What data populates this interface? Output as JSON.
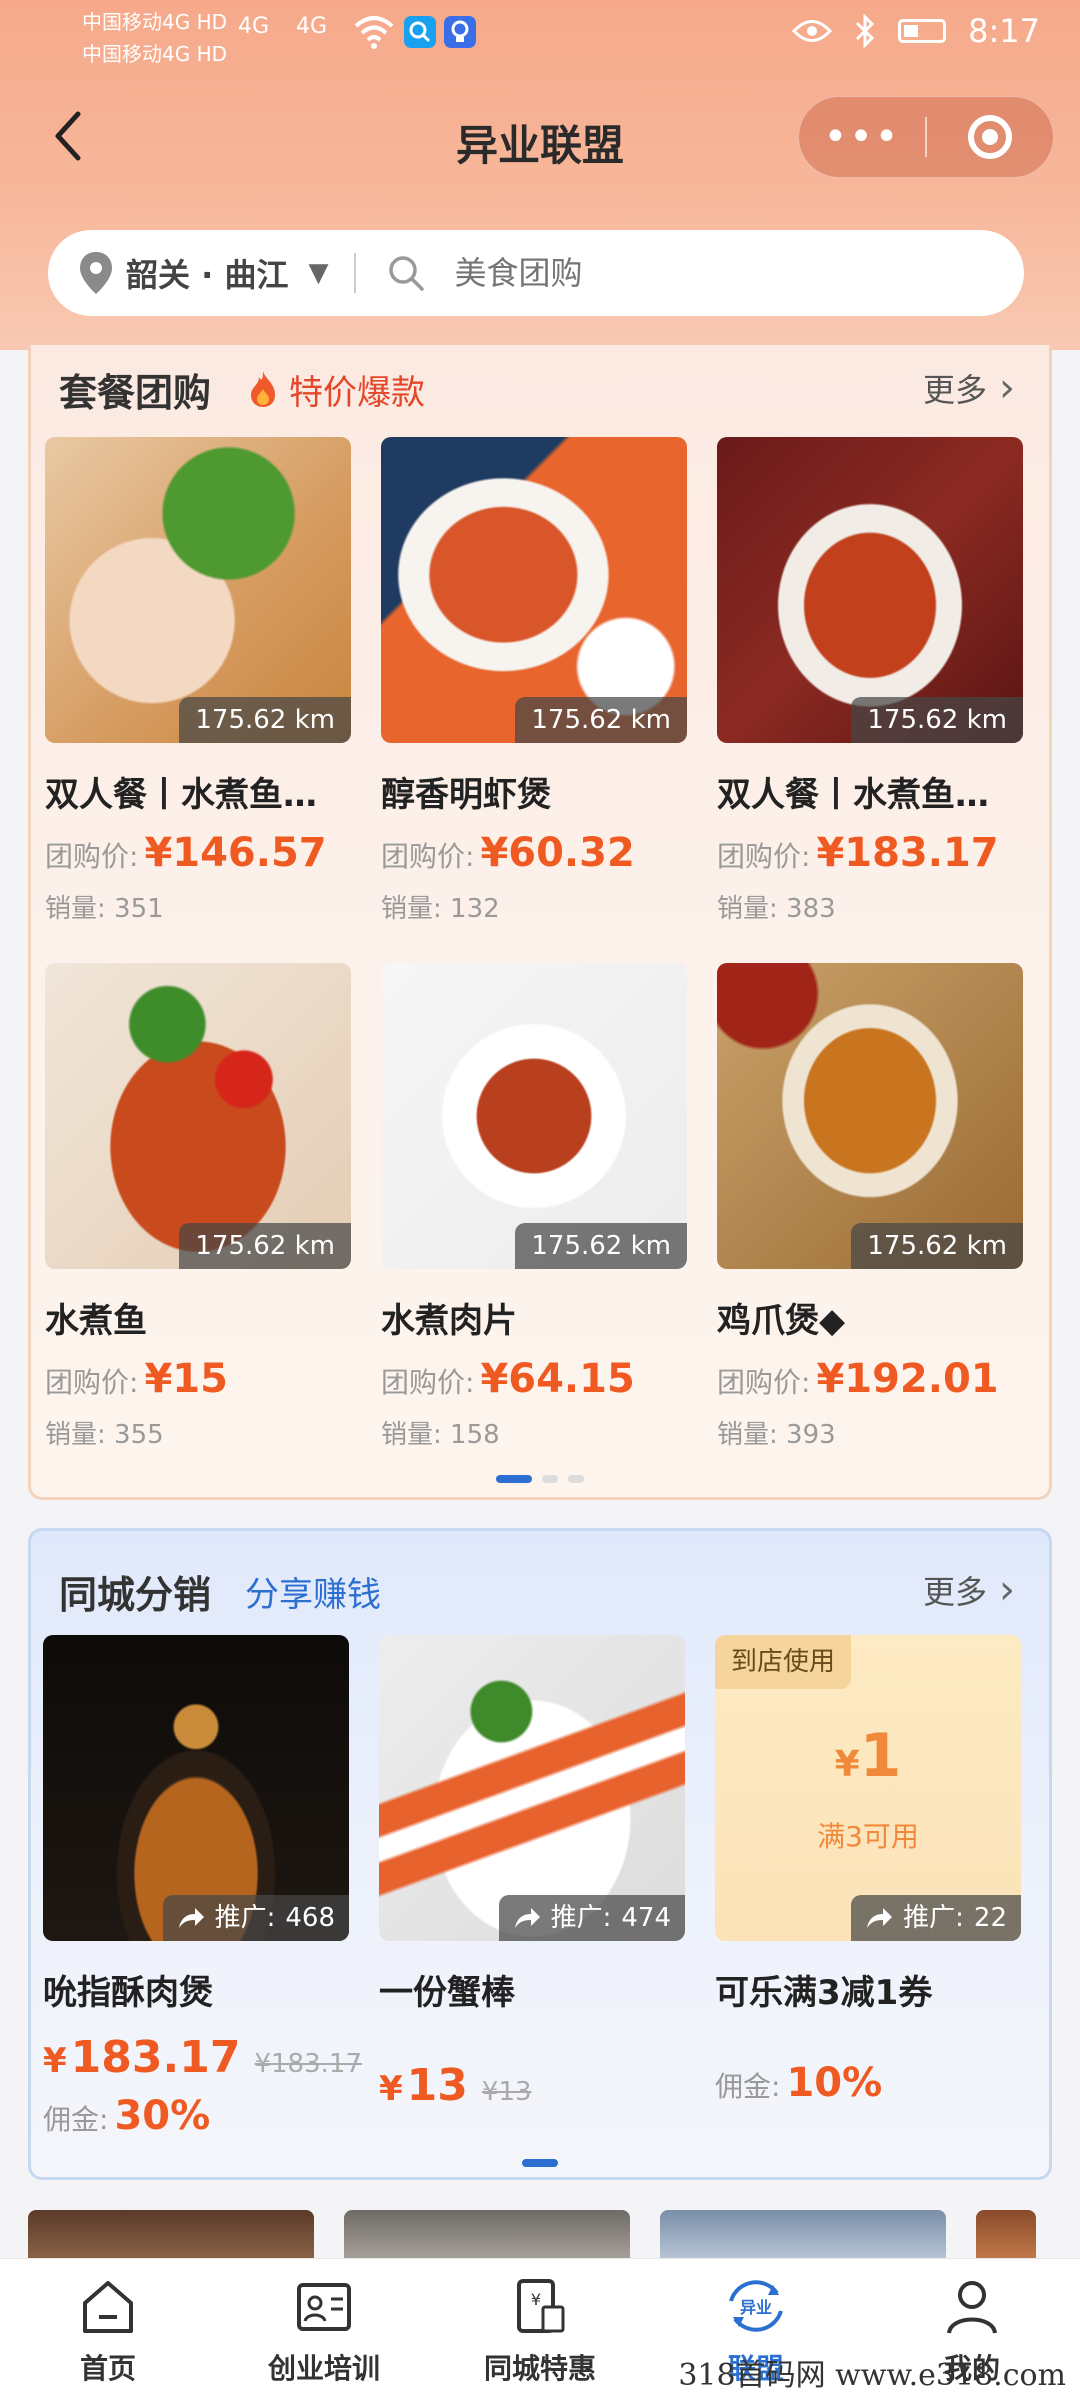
{
  "status_bar": {
    "carrier1": "中国移动4G HD",
    "carrier2": "中国移动4G HD",
    "signal1": "4G",
    "signal2": "4G",
    "time": "8:17"
  },
  "nav": {
    "title": "异业联盟",
    "more_label": "•••"
  },
  "search": {
    "city": "韶关 · 曲江",
    "placeholder": "美食团购"
  },
  "group_buy": {
    "title": "套餐团购",
    "tag": "特价爆款",
    "more": "更多",
    "price_label": "团购价:",
    "sales_label": "销量:",
    "items": [
      {
        "name": "双人餐丨水煮鱼…",
        "price": "¥146.57",
        "sales": "351",
        "distance": "175.62 km"
      },
      {
        "name": "醇香明虾煲",
        "price": "¥60.32",
        "sales": "132",
        "distance": "175.62 km"
      },
      {
        "name": "双人餐丨水煮鱼…",
        "price": "¥183.17",
        "sales": "383",
        "distance": "175.62 km"
      },
      {
        "name": "水煮鱼",
        "price": "¥15",
        "sales": "355",
        "distance": "175.62 km"
      },
      {
        "name": "水煮肉片",
        "price": "¥64.15",
        "sales": "158",
        "distance": "175.62 km"
      },
      {
        "name": "鸡爪煲◆",
        "price": "¥192.01",
        "sales": "393",
        "distance": "175.62 km"
      }
    ]
  },
  "distribution": {
    "title": "同城分销",
    "tag": "分享赚钱",
    "more": "更多",
    "commission_label": "佣金:",
    "promo_label": "推广:",
    "items": [
      {
        "name": "吮指酥肉煲",
        "currency": "¥",
        "price": "183.17",
        "original": "¥183.17",
        "commission": "30%",
        "promo": "468"
      },
      {
        "name": "一份蟹棒",
        "currency": "¥",
        "price": "13",
        "original": "¥13",
        "promo": "474"
      },
      {
        "name": "可乐满3减1券",
        "commission": "10%",
        "promo": "22",
        "coupon_tag": "到店使用",
        "coupon_currency": "¥",
        "coupon_amount": "1",
        "coupon_condition": "满3可用"
      }
    ]
  },
  "tabbar": {
    "items": [
      {
        "label": "首页"
      },
      {
        "label": "创业培训"
      },
      {
        "label": "同城特惠"
      },
      {
        "label": "联盟",
        "icon_text": "异业"
      },
      {
        "label": "我的"
      }
    ]
  },
  "watermark": "318首码网 www.e318.com",
  "colors": {
    "accent_orange": "#ef5a22",
    "accent_blue": "#2b6fd0",
    "header_gradient": "#f6a98a"
  }
}
